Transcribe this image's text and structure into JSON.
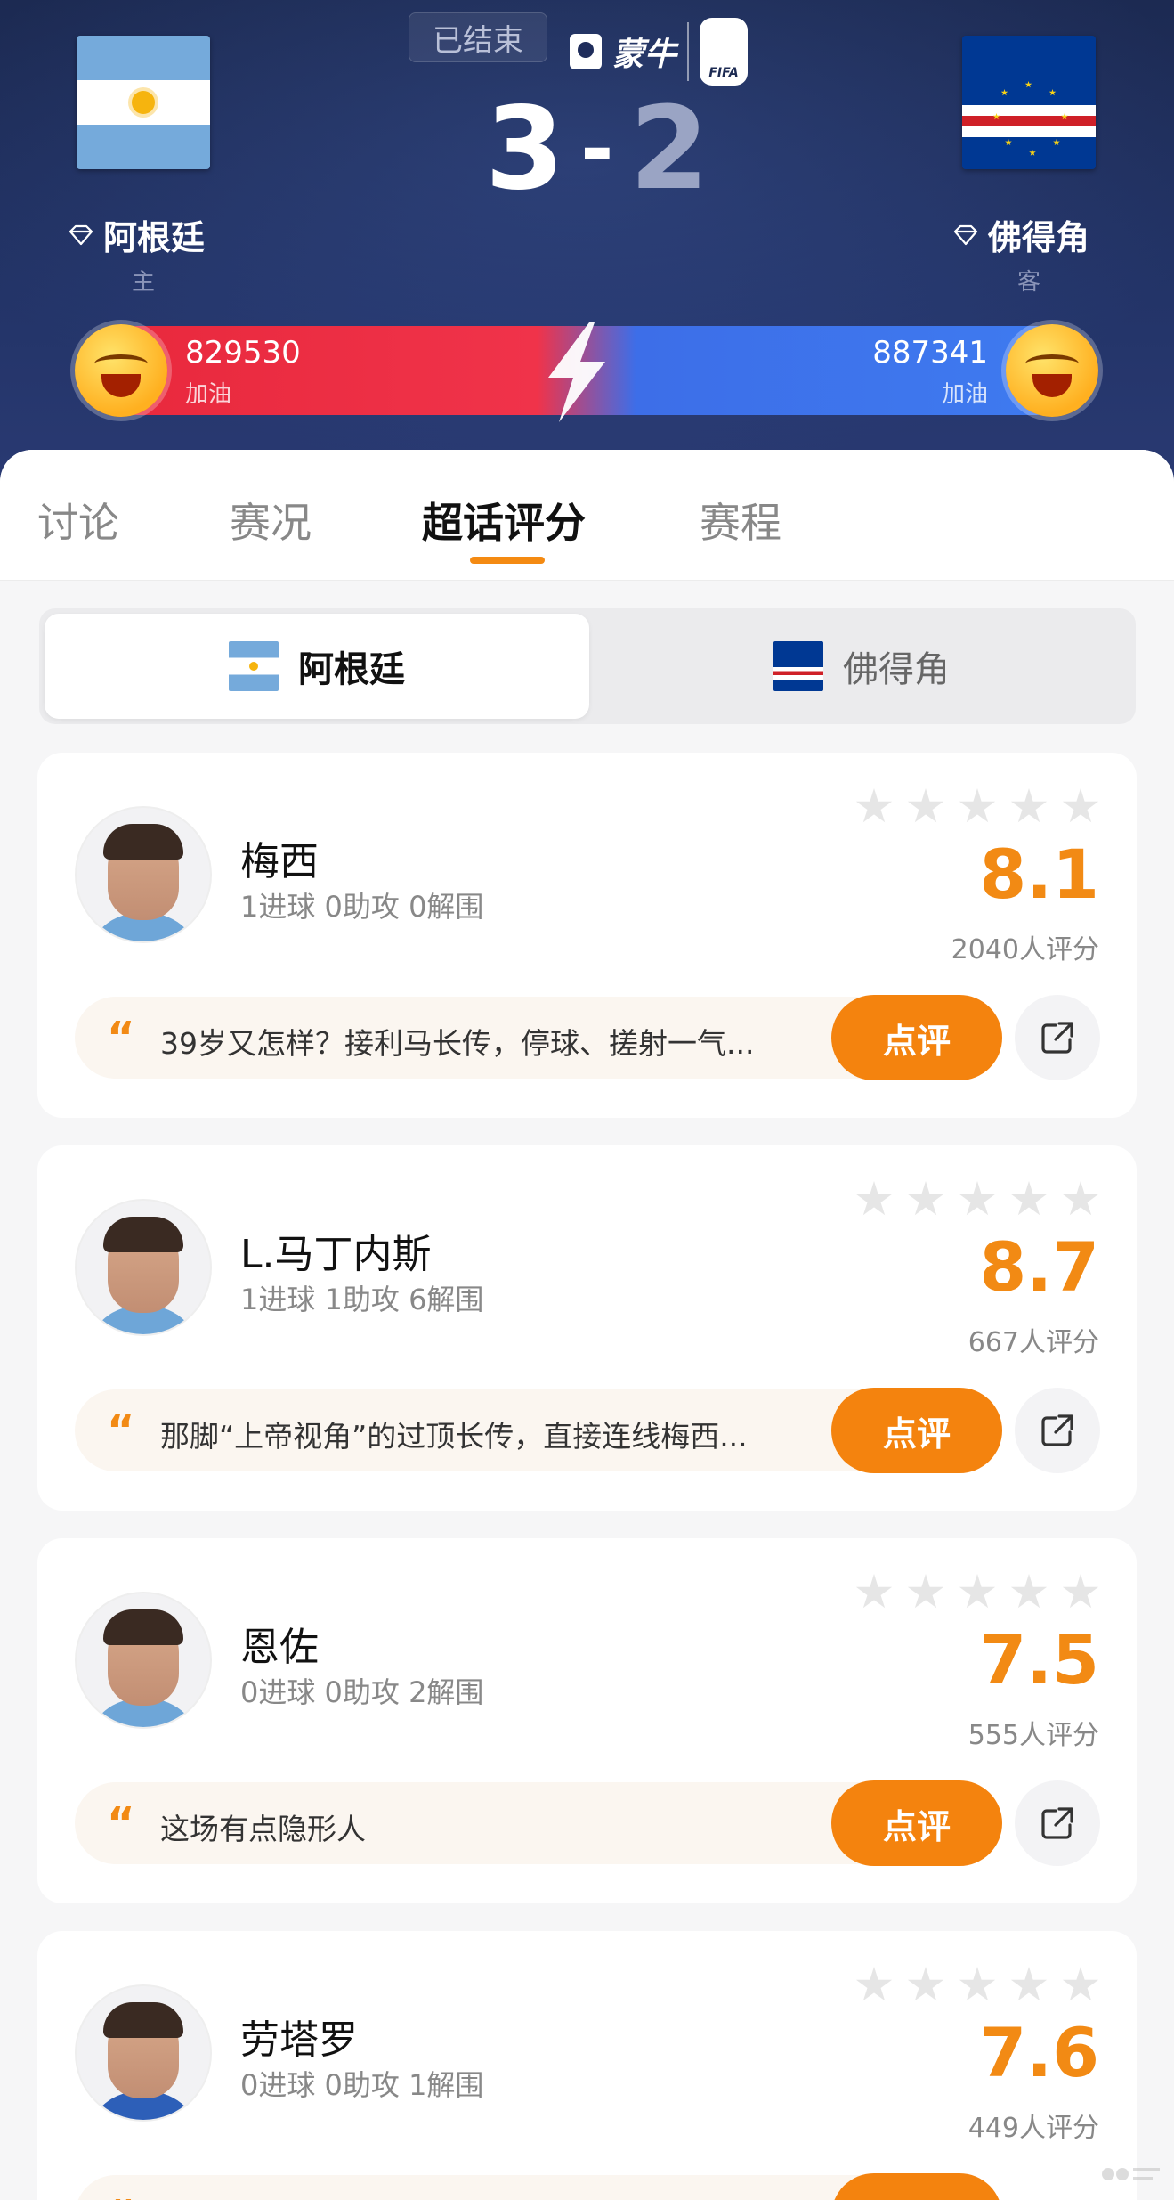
{
  "match": {
    "status": "已结束",
    "brand": "蒙牛",
    "home": {
      "name": "阿根廷",
      "role": "主",
      "score": "3",
      "cheer_count": "829530",
      "cheer_label": "加油"
    },
    "away": {
      "name": "佛得角",
      "role": "客",
      "score": "2",
      "cheer_count": "887341",
      "cheer_label": "加油"
    },
    "score_separator": "-"
  },
  "tabs": [
    "讨论",
    "赛况",
    "超话评分",
    "赛程"
  ],
  "active_tab": "超话评分",
  "team_switch": {
    "home": "阿根廷",
    "away": "佛得角",
    "active": "阿根廷"
  },
  "players": [
    {
      "name": "梅西",
      "stats": "1进球 0助攻 0解围",
      "rating": "8.1",
      "votes": "2040人评分",
      "comment": "39岁又怎样？接利马长传，停球、搓射一气...",
      "review_label": "点评"
    },
    {
      "name": "L.马丁内斯",
      "stats": "1进球 1助攻 6解围",
      "rating": "8.7",
      "votes": "667人评分",
      "comment": "那脚“上帝视角”的过顶长传，直接连线梅西...",
      "review_label": "点评"
    },
    {
      "name": "恩佐",
      "stats": "0进球 0助攻 2解围",
      "rating": "7.5",
      "votes": "555人评分",
      "comment": "这场有点隐形人",
      "review_label": "点评"
    },
    {
      "name": "劳塔罗",
      "stats": "0进球 0助攻 1解围",
      "rating": "7.6",
      "votes": "449人评分",
      "comment": "",
      "review_label": "点评"
    }
  ],
  "colors": {
    "accent": "#f4830e",
    "header_bg": "#1c2a52",
    "home_bar": "#e8283c",
    "away_bar": "#3e7bf0"
  },
  "icons": [
    "diamond-icon",
    "lightning-icon",
    "star-icon",
    "quote-icon",
    "share-icon"
  ]
}
